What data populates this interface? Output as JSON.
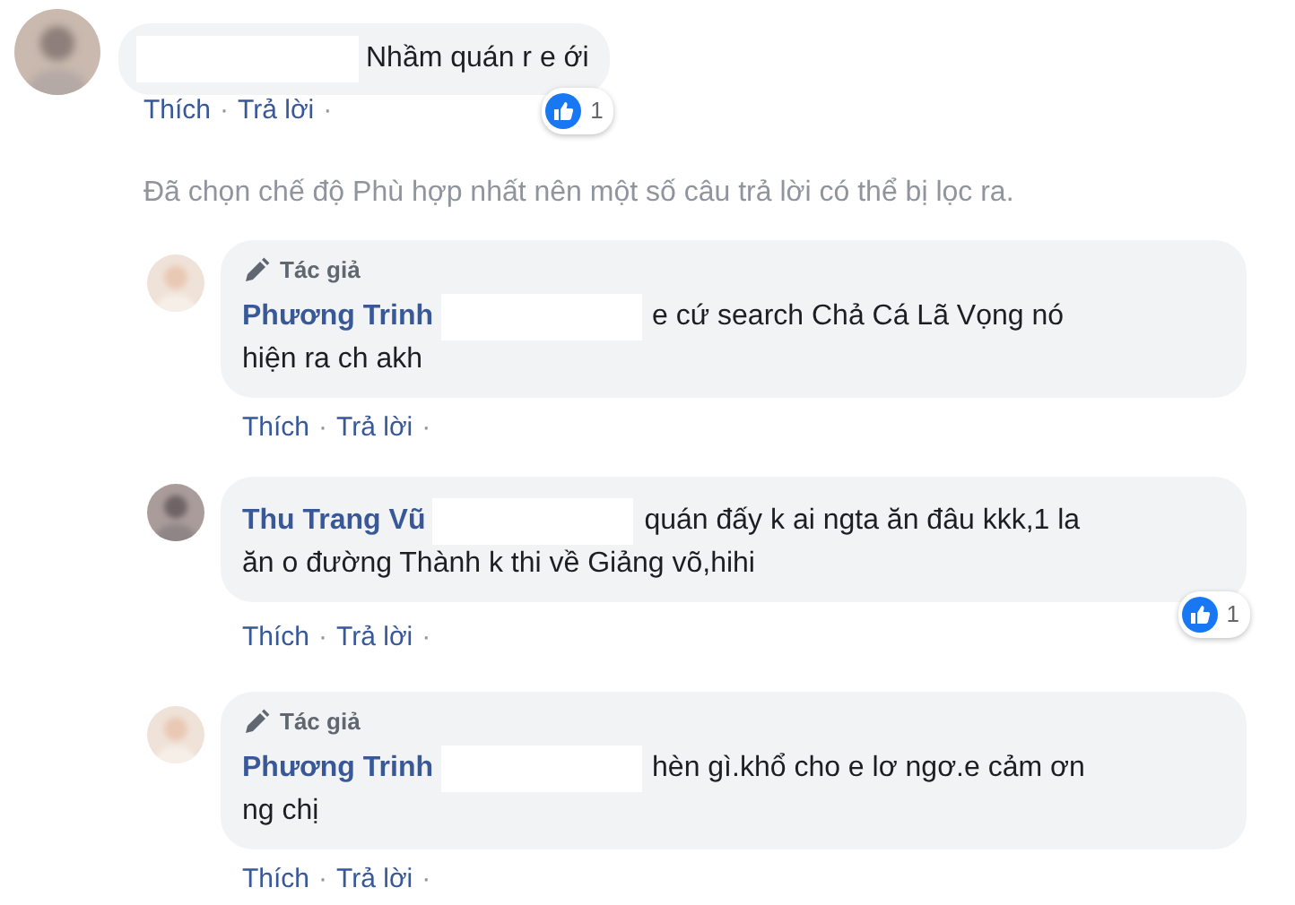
{
  "comment": {
    "text": "Nhầm quán r e ới",
    "reactions": "1",
    "actions": [
      {
        "label": "Thích"
      },
      {
        "label": "Trả lời"
      }
    ]
  },
  "separator": "·",
  "filter_note": "Đã chọn chế độ Phù hợp nhất nên một số câu trả lời có thể bị lọc ra.",
  "replies": [
    {
      "author_badge": "Tác giả",
      "name": "Phương Trinh",
      "text_lines": [
        "e cứ search Chả Cá Lã Vọng nó",
        "hiện ra ch akh"
      ],
      "actions": [
        {
          "label": "Thích"
        },
        {
          "label": "Trả lời"
        }
      ]
    },
    {
      "name": "Thu Trang Vũ",
      "text_lines": [
        "quán đấy k ai ngta ăn đâu kkk,1 la",
        "ăn o đường Thành k thi về Giảng võ,hihi"
      ],
      "reactions": "1",
      "actions": [
        {
          "label": "Thích"
        },
        {
          "label": "Trả lời"
        }
      ]
    },
    {
      "author_badge": "Tác giả",
      "name": "Phương Trinh",
      "text_lines": [
        "hèn gì.khổ cho e lơ ngơ.e cảm ơn",
        "ng chị"
      ],
      "actions": [
        {
          "label": "Thích"
        },
        {
          "label": "Trả lời"
        }
      ]
    }
  ]
}
